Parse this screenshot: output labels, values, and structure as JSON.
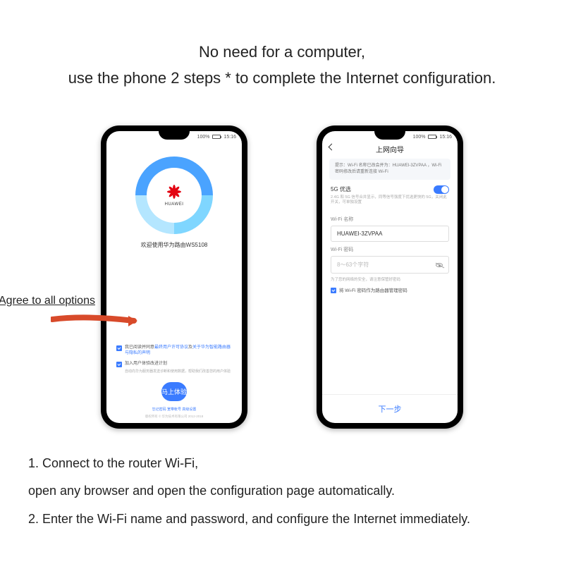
{
  "headline": {
    "line1": "No need for a computer,",
    "line2": "use the phone 2 steps * to complete the Internet configuration."
  },
  "callout": "Agree to all options",
  "statusbar": {
    "battery": "100%",
    "time": "15:16"
  },
  "phone1": {
    "brand": "HUAWEI",
    "welcome": "欢迎使用华为路由WS5108",
    "check1_pre": "我已阅读并同意",
    "check1_link1": "最终用户许可协议",
    "check1_mid": "及",
    "check1_link2": "关于华为智能路由器与隐私的声明",
    "check2": "加入用户体验改进计划",
    "check2_sub": "自动向华为服务器发送诊断和使用数据，帮助我们改善您的用户体验",
    "button": "马上体验",
    "footer_links": "忘记密码  宽带帐号  高级设置",
    "copyright": "版权所有 © 华为技术有限公司 2012-2018"
  },
  "phone2": {
    "title": "上网向导",
    "info": "提示：Wi-Fi 名称已改会并为：HUAWEI-3ZVPAA ，Wi-Fi 密码修改后请重新连接 Wi-Fi",
    "opt5g_title": "5G 优选",
    "opt5g_desc": "2.4G 和 5G 信号合并显示，同等信号强度下优选更快的 5G，关闭此开关，可单独设置",
    "wifi_name_label": "Wi-Fi 名称",
    "wifi_name_value": "HUAWEI-3ZVPAA",
    "wifi_pwd_label": "Wi-Fi 密码",
    "wifi_pwd_placeholder": "8～63个字符",
    "hint": "为了您的网络的安全，请注意保管好密码",
    "same_pwd": "将 Wi-Fi 密码作为路由器管理密码",
    "next": "下一步"
  },
  "steps": {
    "s1a": "1. Connect to the router Wi-Fi,",
    "s1b": "open any browser and open the configuration page automatically.",
    "s2": "2. Enter the Wi-Fi name and password, and configure the Internet immediately."
  }
}
